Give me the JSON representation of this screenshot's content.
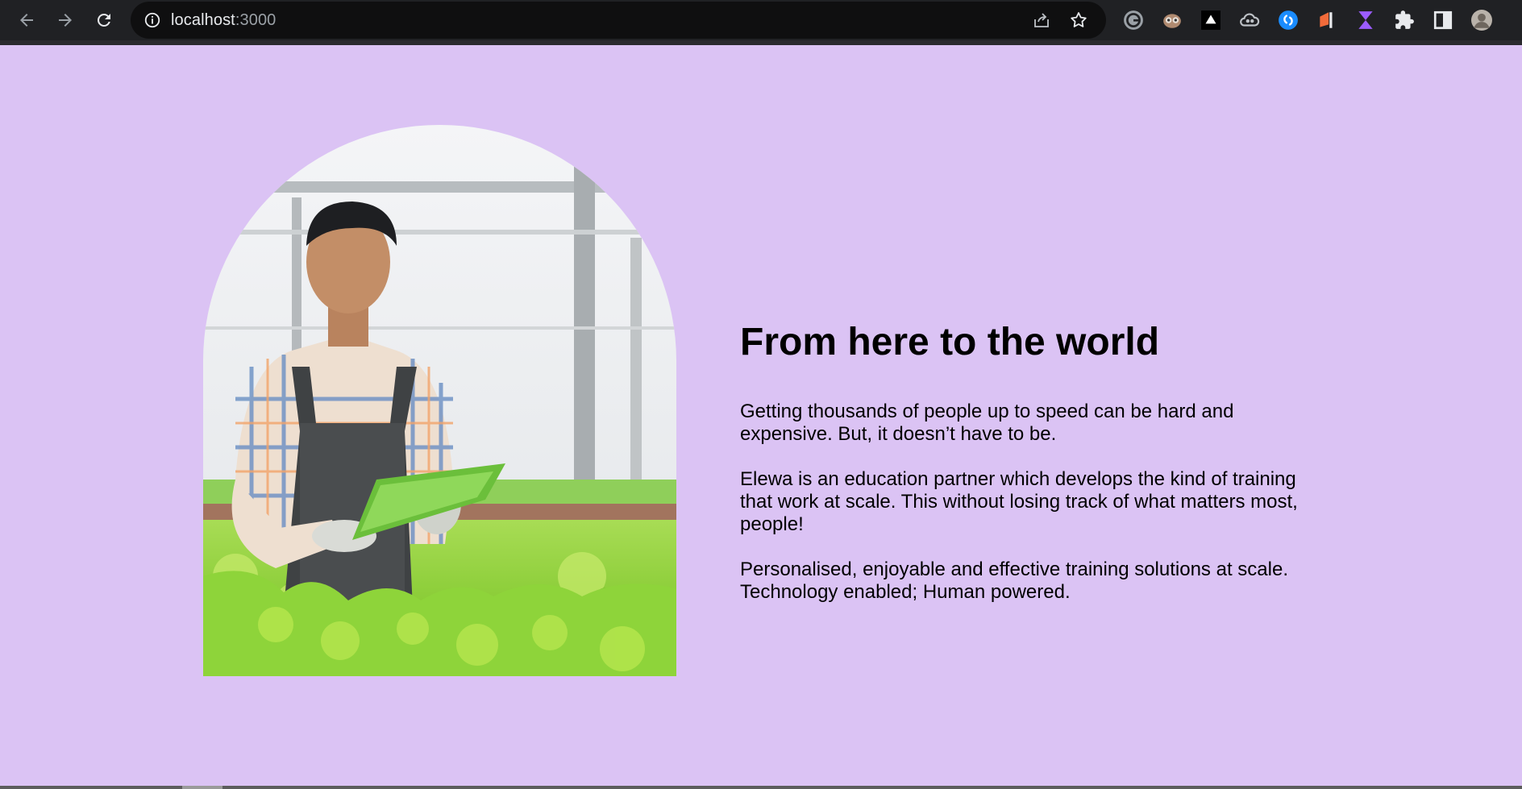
{
  "browser": {
    "url_host": "localhost",
    "url_port": ":3000",
    "icons": {
      "back": "arrow-left",
      "forward": "arrow-right",
      "reload": "reload",
      "site_info": "info-circle",
      "share": "share",
      "bookmark": "star"
    },
    "extensions": [
      "grammarly-icon",
      "owl-icon",
      "triangle-icon",
      "cloud-icon",
      "shazam-icon",
      "flag-icon",
      "hourglass-icon",
      "puzzle-icon",
      "side-panel-icon",
      "profile-avatar"
    ]
  },
  "page": {
    "background_color": "#dbc3f4",
    "hero_image_alt": "",
    "headline": "From here to the world",
    "paragraphs": [
      "Getting thousands of people up to speed can be hard and expensive. But, it doesn’t have to be.",
      "Elewa is an education partner which develops the kind of training that work at scale. This without losing track of what matters most, people!",
      "Personalised, enjoyable and effective training solutions at scale. Technology enabled; Human powered."
    ]
  }
}
